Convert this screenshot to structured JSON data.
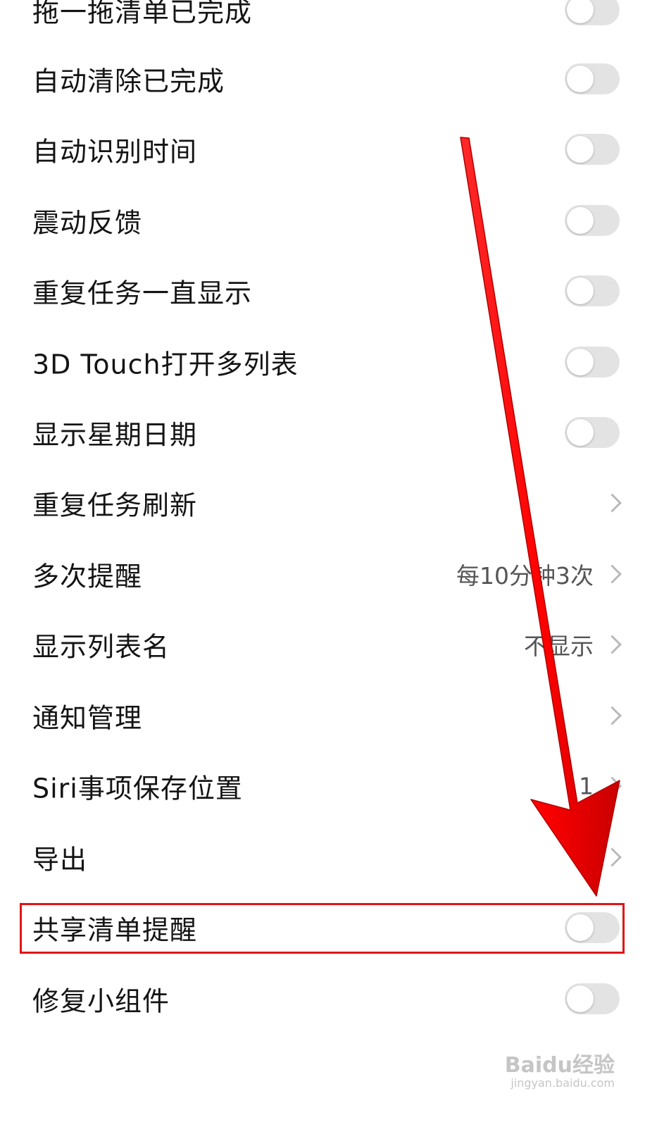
{
  "settings": {
    "partial_top_label": "拖一拖清单已完成",
    "items": [
      {
        "label": "自动清除已完成",
        "type": "toggle",
        "on": false
      },
      {
        "label": "自动识别时间",
        "type": "toggle",
        "on": false
      },
      {
        "label": "震动反馈",
        "type": "toggle",
        "on": false
      },
      {
        "label": "重复任务一直显示",
        "type": "toggle",
        "on": false
      },
      {
        "label": "3D Touch打开多列表",
        "type": "toggle",
        "on": false
      },
      {
        "label": "显示星期日期",
        "type": "toggle",
        "on": false
      },
      {
        "label": "重复任务刷新",
        "type": "nav"
      },
      {
        "label": "多次提醒",
        "type": "nav",
        "value": "每10分钟3次"
      },
      {
        "label": "显示列表名",
        "type": "nav",
        "value": "不显示"
      },
      {
        "label": "通知管理",
        "type": "nav"
      },
      {
        "label": "Siri事项保存位置",
        "type": "nav",
        "value": "1"
      },
      {
        "label": "导出",
        "type": "nav"
      },
      {
        "label": "共享清单提醒",
        "type": "toggle",
        "on": false
      },
      {
        "label": "修复小组件",
        "type": "toggle",
        "on": false
      }
    ]
  },
  "annotation": {
    "highlight_color": "#e01515",
    "arrow_color": "#ff0000"
  },
  "watermark": {
    "brand": "Baidu经验",
    "url": "jingyan.baidu.com"
  }
}
